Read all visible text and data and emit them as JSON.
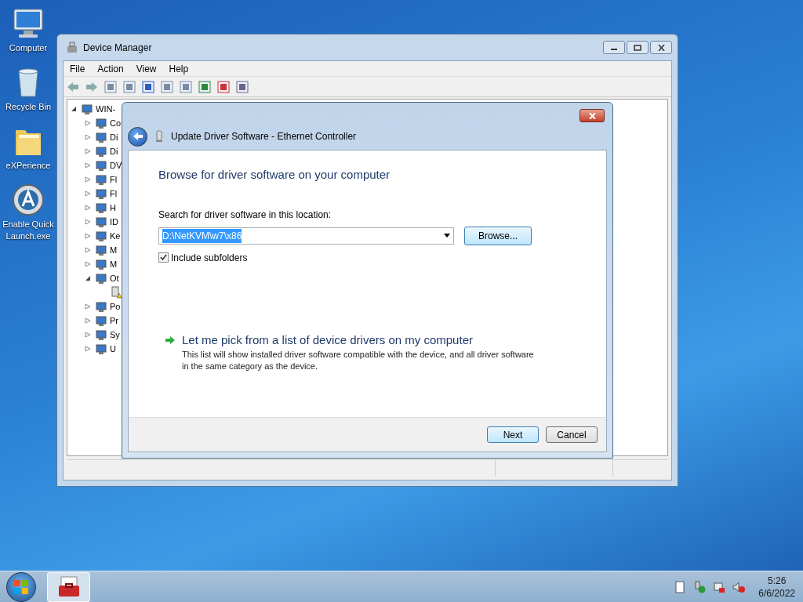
{
  "desktop_icons": [
    {
      "kind": "computer",
      "label": "Computer"
    },
    {
      "kind": "bin",
      "label": "Recycle Bin"
    },
    {
      "kind": "folder",
      "label": "eXPerience"
    },
    {
      "kind": "app",
      "label": "Enable Quick Launch.exe"
    }
  ],
  "device_manager": {
    "title": "Device Manager",
    "menu": [
      "File",
      "Action",
      "View",
      "Help"
    ],
    "tree": {
      "label": "WIN-",
      "expanded": true,
      "children": [
        {
          "label": "Co",
          "expanded": false
        },
        {
          "label": "Di",
          "expanded": false
        },
        {
          "label": "Di",
          "expanded": false
        },
        {
          "label": "DV",
          "expanded": false
        },
        {
          "label": "Fl",
          "expanded": false
        },
        {
          "label": "Fl",
          "expanded": false
        },
        {
          "label": "H",
          "expanded": false
        },
        {
          "label": "ID",
          "expanded": false
        },
        {
          "label": "Ke",
          "expanded": false
        },
        {
          "label": "M",
          "expanded": false
        },
        {
          "label": "M",
          "expanded": false
        },
        {
          "label": "Ot",
          "expanded": true,
          "children": [
            {
              "warning": true
            }
          ]
        },
        {
          "label": "Po",
          "expanded": false
        },
        {
          "label": "Pr",
          "expanded": false
        },
        {
          "label": "Sy",
          "expanded": false
        },
        {
          "label": "U",
          "expanded": false
        }
      ]
    }
  },
  "dialog": {
    "title": "Update Driver Software - Ethernet Controller",
    "heading": "Browse for driver software on your computer",
    "location_label": "Search for driver software in this location:",
    "location": {
      "value": "D:\\NetKVM\\w7\\x86",
      "text_selected": true
    },
    "browse_button": "Browse...",
    "include_subfolders": {
      "label": "Include subfolders",
      "checked": true
    },
    "pick_option": {
      "title": "Let me pick from a list of device drivers on my computer",
      "description": "This list will show installed driver software compatible with the device, and all driver software in the same category as the device."
    },
    "buttons": [
      {
        "label": "Next",
        "default": true
      },
      {
        "label": "Cancel",
        "default": false
      }
    ]
  },
  "taskbar": {
    "apps": [
      {
        "kind": "toolbox",
        "selected": true
      }
    ],
    "time": "5:26",
    "date": "6/6/2022"
  }
}
